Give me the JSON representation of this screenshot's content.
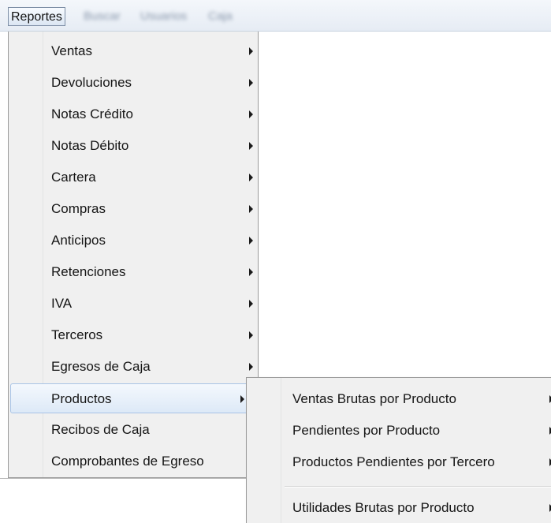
{
  "menubar": {
    "active_label": "Reportes",
    "blurred_items": [
      "Buscar",
      "Usuarios",
      "Caja"
    ]
  },
  "dropdown": {
    "items": [
      {
        "label": "Ventas",
        "has_submenu": true
      },
      {
        "label": "Devoluciones",
        "has_submenu": true
      },
      {
        "label": "Notas Crédito",
        "has_submenu": true
      },
      {
        "label": "Notas Débito",
        "has_submenu": true
      },
      {
        "label": "Cartera",
        "has_submenu": true
      },
      {
        "label": "Compras",
        "has_submenu": true
      },
      {
        "label": "Anticipos",
        "has_submenu": true
      },
      {
        "label": "Retenciones",
        "has_submenu": true
      },
      {
        "label": "IVA",
        "has_submenu": true
      },
      {
        "label": "Terceros",
        "has_submenu": true
      },
      {
        "label": "Egresos de Caja",
        "has_submenu": true
      },
      {
        "label": "Productos",
        "has_submenu": true,
        "highlighted": true
      },
      {
        "label": "Recibos de Caja",
        "has_submenu": true
      },
      {
        "label": "Comprobantes de Egreso",
        "has_submenu": true
      }
    ]
  },
  "submenu": {
    "items": [
      {
        "label": "Ventas Brutas por Producto",
        "has_submenu": true
      },
      {
        "label": "Pendientes por Producto",
        "has_submenu": true
      },
      {
        "label": "Productos Pendientes por Tercero",
        "has_submenu": true
      },
      {
        "label": "Utilidades Brutas por Producto",
        "has_submenu": true
      }
    ]
  },
  "colors": {
    "highlight_border": "#a9c4e6",
    "menu_background": "#f0f0f0"
  }
}
